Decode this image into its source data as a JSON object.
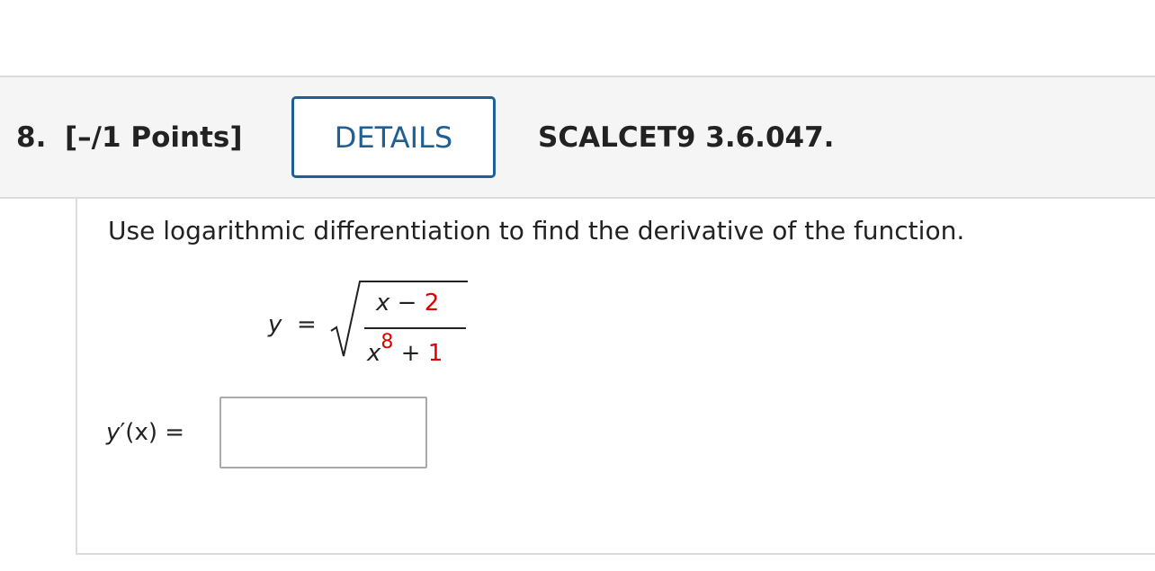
{
  "question": {
    "number": "8.",
    "points": "[–/1 Points]",
    "details_label": "DETAILS",
    "reference": "SCALCET9 3.6.047."
  },
  "problem": {
    "prompt": "Use logarithmic differentiation to find the derivative of the function.",
    "function": {
      "lhs": "y",
      "equals": "=",
      "numerator_var": "x",
      "numerator_op": " − ",
      "numerator_const": "2",
      "denominator_var": "x",
      "denominator_exponent": "8",
      "denominator_op": " + ",
      "denominator_const": "1"
    },
    "answer": {
      "label_var": "y",
      "label_rest": "′(x) =",
      "value": "",
      "placeholder": ""
    }
  },
  "colors": {
    "accent": "#1f5f94",
    "highlight": "#e10000",
    "header_bg": "#f5f5f5",
    "border": "#dcdcdc"
  }
}
